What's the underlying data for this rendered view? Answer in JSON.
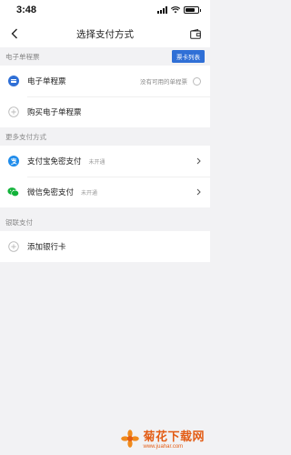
{
  "status_bar": {
    "time": "3:48"
  },
  "nav": {
    "title": "选择支付方式"
  },
  "sections": {
    "ticket": {
      "header": "电子单程票",
      "list_button": "票卡列表",
      "items": [
        {
          "label": "电子单程票",
          "hint": "没有可用的单程票"
        },
        {
          "label": "购买电子单程票"
        }
      ]
    },
    "more": {
      "header": "更多支付方式",
      "items": [
        {
          "label": "支付宝免密支付",
          "status": "未开通"
        },
        {
          "label": "微信免密支付",
          "status": "未开通"
        }
      ]
    },
    "bank": {
      "header": "银联支付",
      "items": [
        {
          "label": "添加银行卡"
        }
      ]
    }
  },
  "watermark": {
    "title": "菊花下载网",
    "url": "www.juahar.com"
  },
  "colors": {
    "accent": "#2f6fd6",
    "alipay": "#1f8ceb",
    "wechat": "#12b33a",
    "watermark": "#e35d16"
  }
}
